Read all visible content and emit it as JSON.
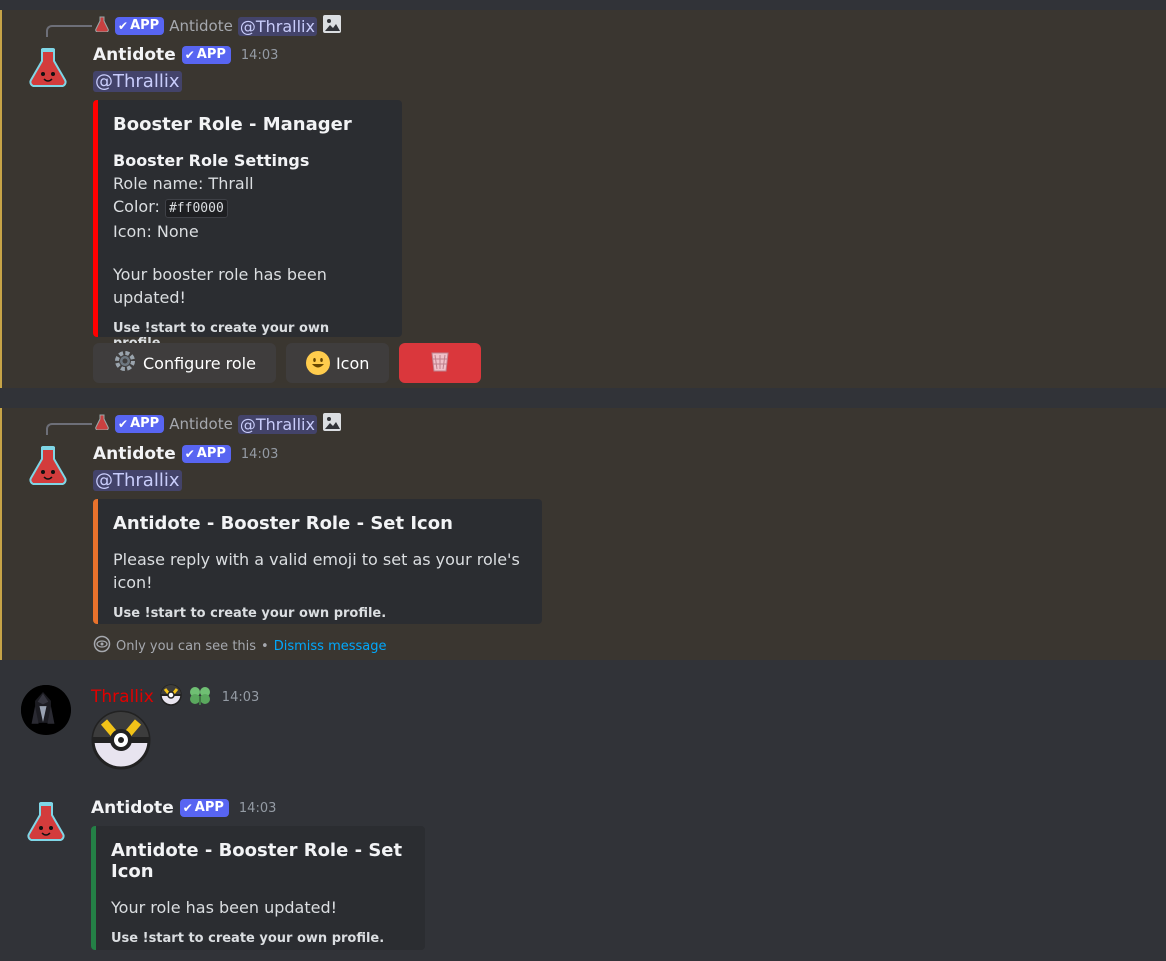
{
  "colors": {
    "background": "#313338",
    "highlight_bg": "#3a3630",
    "highlight_border": "#c6a447",
    "blurple": "#5865f2",
    "embed_red": "#ff0000",
    "embed_orange": "#e8722c",
    "embed_green": "#248046",
    "danger": "#da373c"
  },
  "messages": [
    {
      "reply": {
        "author": "Antidote",
        "badge": "APP",
        "mention": "@Thrallix",
        "attachment_icon": "image-icon"
      },
      "author": "Antidote",
      "badge": "APP",
      "time": "14:03",
      "mention": "@Thrallix",
      "embed": {
        "title": "Booster Role - Manager",
        "subtitle": "Booster Role Settings",
        "role_name": "Role name: Thrall",
        "color_label": "Color:",
        "color_value": "#ff0000",
        "icon_line": "Icon: None",
        "status": "Your booster role has been updated!",
        "footer": "Use !start to create your own profile."
      },
      "buttons": [
        {
          "label": "Configure role",
          "icon": "gear-icon"
        },
        {
          "label": "Icon",
          "icon": "smiley-icon"
        },
        {
          "label": "",
          "icon": "wastebasket-icon"
        }
      ]
    },
    {
      "reply": {
        "author": "Antidote",
        "badge": "APP",
        "mention": "@Thrallix",
        "attachment_icon": "image-icon"
      },
      "author": "Antidote",
      "badge": "APP",
      "time": "14:03",
      "mention": "@Thrallix",
      "embed": {
        "title": "Antidote - Booster Role - Set Icon",
        "body": "Please reply with a valid emoji to set as your role's icon!",
        "footer": "Use !start to create your own profile."
      },
      "ephemeral": {
        "text": "Only you can see this",
        "separator": "•",
        "link": "Dismiss message"
      }
    },
    {
      "author": "Thrallix",
      "time": "14:03",
      "content_emoji": "ultra-ball-icon"
    },
    {
      "author": "Antidote",
      "badge": "APP",
      "time": "14:03",
      "embed": {
        "title": "Antidote - Booster Role - Set Icon",
        "body": "Your role has been updated!",
        "footer": "Use !start to create your own profile."
      }
    }
  ]
}
